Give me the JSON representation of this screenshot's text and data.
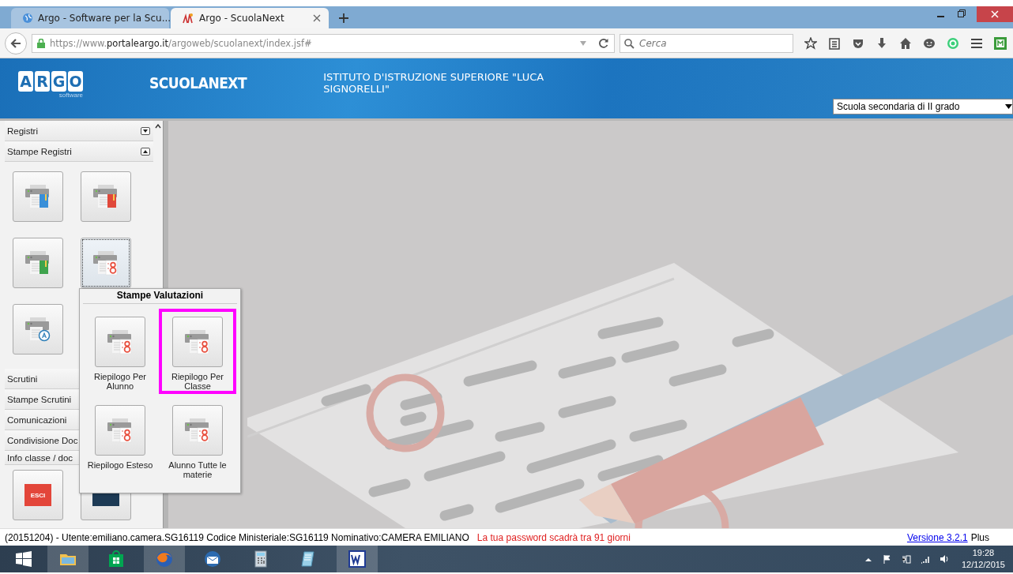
{
  "browser": {
    "tabs": [
      {
        "title": "Argo - Software per la Scu...",
        "selected": false
      },
      {
        "title": "Argo - ScuolaNext",
        "selected": true
      }
    ],
    "url": {
      "prefix": "https://www.",
      "domain": "portaleargo.it",
      "path": "/argoweb/scuolanext/index.jsf#"
    },
    "search": {
      "placeholder": "Cerca"
    }
  },
  "header": {
    "logo_letters": [
      "A",
      "R",
      "G",
      "O"
    ],
    "logo_sub": "software",
    "product": "SCUOLANEXT",
    "institute": "ISTITUTO D'ISTRUZIONE SUPERIORE \"LUCA SIGNORELLI\"",
    "school_type": "Scuola secondaria di II grado"
  },
  "sidebar": {
    "sections": [
      {
        "label": "Registri",
        "expanded": false
      },
      {
        "label": "Stampe Registri",
        "expanded": true,
        "items": [
          {
            "kind": "book",
            "color": "#3a8fd8",
            "selected": false
          },
          {
            "kind": "book",
            "color": "#e0483a",
            "selected": false
          },
          {
            "kind": "book",
            "color": "#3fa34d",
            "selected": false
          },
          {
            "kind": "grades",
            "selected": true
          },
          {
            "kind": "letter",
            "selected": false
          }
        ]
      },
      {
        "label": "Scrutini"
      },
      {
        "label": "Stampe Scrutini"
      },
      {
        "label": "Comunicazioni"
      },
      {
        "label": "Condivisione Doc"
      },
      {
        "label": "Info classe / doc"
      }
    ],
    "exit_label": "ESCI"
  },
  "popup": {
    "title": "Stampe Valutazioni",
    "items": [
      {
        "label": "Riepilogo Per Alunno",
        "selected": false
      },
      {
        "label": "Riepilogo Per Classe",
        "selected": true
      },
      {
        "label": "Riepilogo Esteso",
        "selected": false
      },
      {
        "label": "Alunno Tutte le materie",
        "selected": false
      }
    ]
  },
  "status_bar": {
    "user_info": "(20151204) - Utente:emiliano.camera.SG16119 Codice Ministeriale:SG16119 Nominativo:CAMERA EMILIANO",
    "warning": "La tua password scadrà tra 91 giorni",
    "version_link": "Versione 3.2.1",
    "edition": "Plus"
  },
  "taskbar": {
    "apps": [
      {
        "kind": "explorer",
        "running": true
      },
      {
        "kind": "store",
        "running": false
      },
      {
        "kind": "firefox",
        "running": true
      },
      {
        "kind": "mail",
        "running": false
      },
      {
        "kind": "calculator",
        "running": false
      },
      {
        "kind": "notepad",
        "running": false
      },
      {
        "kind": "word",
        "running": true
      }
    ],
    "time": "19:28",
    "date": "12/12/2015"
  }
}
